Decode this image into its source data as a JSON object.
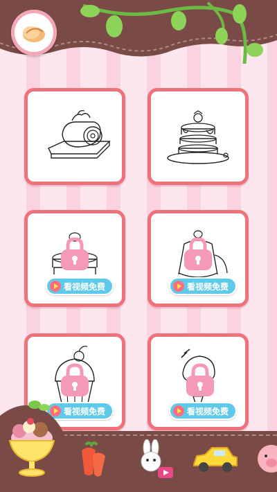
{
  "cards": [
    {
      "name": "swiss-roll",
      "locked": false
    },
    {
      "name": "pancakes",
      "locked": false
    },
    {
      "name": "pancakes-2",
      "locked": true,
      "unlock_label": "看视频免费"
    },
    {
      "name": "pudding",
      "locked": true,
      "unlock_label": "看视频免费"
    },
    {
      "name": "cupcake",
      "locked": true,
      "unlock_label": "看视频免费"
    },
    {
      "name": "ice-cream-cone",
      "locked": true,
      "unlock_label": "看视频免费"
    }
  ],
  "icons": {
    "back": "bread-icon",
    "footer": [
      "ice-cream-sundae-icon",
      "carrot-icon",
      "bunny-video-icon",
      "car-icon",
      "pig-icon"
    ]
  },
  "colors": {
    "card_border": "#ee727c",
    "unlock_button": "#5ec9e8",
    "lock": "#f49ab6",
    "footer": "#7a4a46",
    "header": "#7a4a46"
  }
}
